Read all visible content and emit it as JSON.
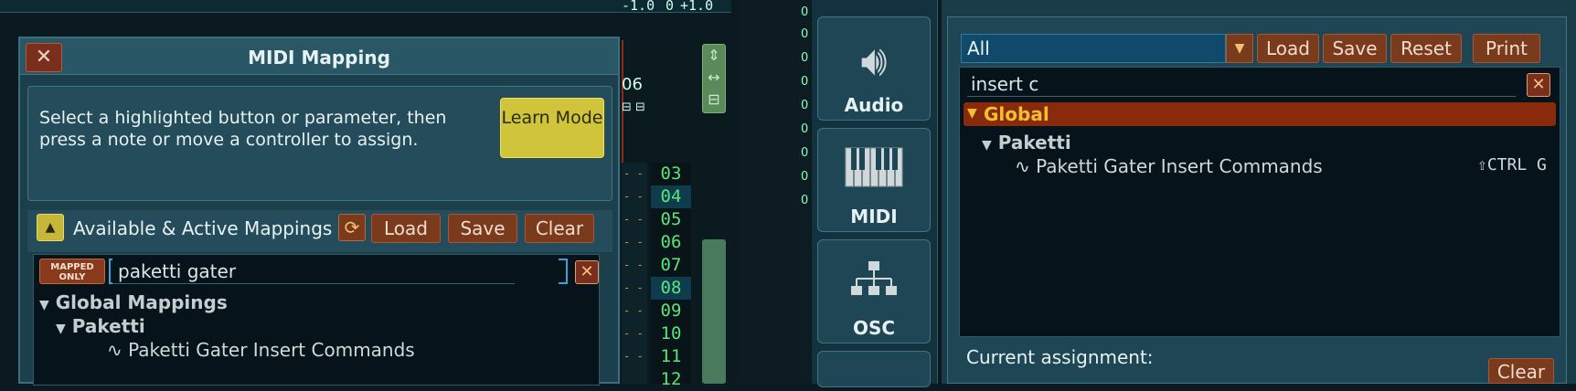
{
  "background": {
    "top_values": [
      "-1.0",
      "0",
      "+1.0"
    ],
    "mid_label": "06",
    "row_numbers": [
      "03",
      "04",
      "05",
      "06",
      "07",
      "08",
      "09",
      "10",
      "11",
      "12"
    ],
    "highlighted_rows": [
      "04",
      "08"
    ],
    "right_edge_numbers": [
      "0",
      "0",
      "0",
      "0",
      "0",
      "0",
      "0",
      "0",
      "0"
    ]
  },
  "midi_dialog": {
    "title": "MIDI Mapping",
    "close_icon": "close-icon",
    "instructions": "Select a highlighted button or parameter, then press a note or move a controller to assign.",
    "learn_mode_label": "Learn Mode",
    "mappings_title": "Available & Active Mappings",
    "load_label": "Load",
    "save_label": "Save",
    "clear_label": "Clear",
    "mapped_only_label": "MAPPED ONLY",
    "search_value": "paketti gater",
    "tree": {
      "root": "Global Mappings",
      "group": "Paketti",
      "item": "∿ Paketti Gater Insert Commands"
    }
  },
  "sidebar": {
    "items": [
      {
        "label": "Audio",
        "icon": "speaker-icon"
      },
      {
        "label": "MIDI",
        "icon": "keyboard-icon"
      },
      {
        "label": "OSC",
        "icon": "network-icon"
      }
    ]
  },
  "keybindings": {
    "preset_value": "All",
    "load_label": "Load",
    "save_label": "Save",
    "reset_label": "Reset",
    "print_label": "Print",
    "search_value": "insert c",
    "tree": {
      "root": "Global",
      "group": "Paketti",
      "item": "∿ Paketti Gater Insert Commands",
      "shortcut": "⇧CTRL G"
    },
    "current_assignment_label": "Current assignment:",
    "clear_label": "Clear"
  },
  "colors": {
    "accent_yellow": "#d0c43a",
    "button_brown": "#7a3a1c",
    "global_row": "#8a2a0c",
    "row_number_green": "#5de37a"
  }
}
